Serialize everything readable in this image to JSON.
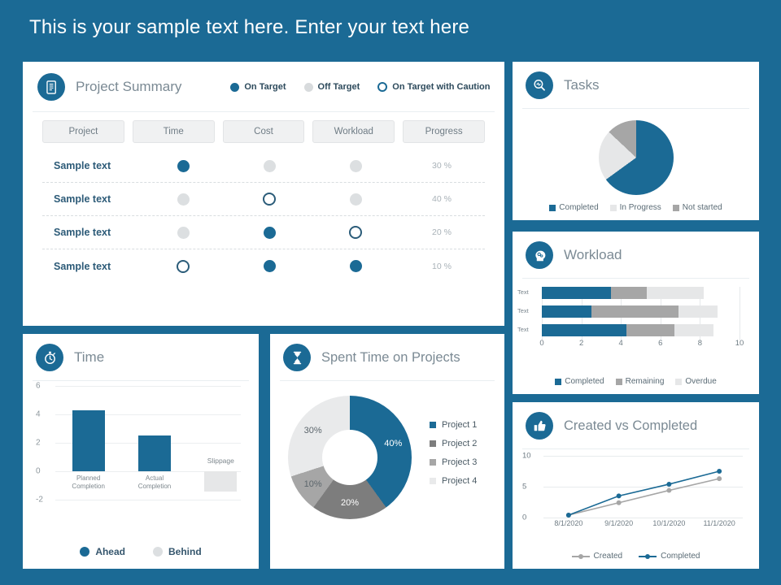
{
  "header": {
    "title": "This is your sample text here. Enter your text here"
  },
  "theme": {
    "brand_blue": "#1b6a95",
    "dark_gray": "#7d7d7d",
    "mid_gray": "#a6a6a6",
    "light_gray": "#e6e7e8",
    "pale_gray": "#d9dcde"
  },
  "project_summary": {
    "title": "Project Summary",
    "icon": "document-list-icon",
    "legend": [
      {
        "label": "On Target",
        "style": "filled"
      },
      {
        "label": "Off Target",
        "style": "gray"
      },
      {
        "label": "On Target with Caution",
        "style": "ring"
      }
    ],
    "columns": [
      "Project",
      "Time",
      "Cost",
      "Workload",
      "Progress"
    ],
    "rows": [
      {
        "name": "Sample text",
        "time": "filled",
        "cost": "gray",
        "workload": "gray",
        "progress": "30 %"
      },
      {
        "name": "Sample text",
        "time": "gray",
        "cost": "ring",
        "workload": "gray",
        "progress": "40 %"
      },
      {
        "name": "Sample text",
        "time": "gray",
        "cost": "filled",
        "workload": "ring",
        "progress": "20 %"
      },
      {
        "name": "Sample text",
        "time": "ring",
        "cost": "filled",
        "workload": "filled",
        "progress": "10 %"
      }
    ]
  },
  "tasks": {
    "title": "Tasks",
    "icon": "magnifier-analytics-icon",
    "chart_data": {
      "type": "pie",
      "title": "Tasks",
      "categories": [
        "Completed",
        "In Progress",
        "Not started"
      ],
      "values": [
        65,
        22,
        13
      ],
      "colors": [
        "#1b6a95",
        "#e6e7e8",
        "#a6a6a6"
      ],
      "legend_position": "bottom"
    }
  },
  "workload": {
    "title": "Workload",
    "icon": "head-gears-icon",
    "chart_data": {
      "type": "bar",
      "orientation": "horizontal",
      "stacked": true,
      "title": "Workload",
      "categories": [
        "Text",
        "Text",
        "Text"
      ],
      "series": [
        {
          "name": "Completed",
          "color": "#1b6a95",
          "values": [
            3.5,
            2.5,
            4.3
          ]
        },
        {
          "name": "Remaining",
          "color": "#a6a6a6",
          "values": [
            1.8,
            4.4,
            2.4
          ]
        },
        {
          "name": "Overdue",
          "color": "#e6e7e8",
          "values": [
            2.9,
            2.0,
            2.0
          ]
        }
      ],
      "xticks": [
        0,
        2,
        4,
        6,
        8,
        10
      ],
      "xlim": [
        0,
        10
      ],
      "grid": true,
      "legend_position": "bottom"
    }
  },
  "created_vs_completed": {
    "title": "Created vs Completed",
    "icon": "thumbs-up-icon",
    "chart_data": {
      "type": "line",
      "title": "Created vs Completed",
      "x": [
        "8/1/2020",
        "9/1/2020",
        "10/1/2020",
        "11/1/2020"
      ],
      "series": [
        {
          "name": "Created",
          "color": "#a6a6a6",
          "values": [
            0.4,
            2.4,
            4.4,
            6.3
          ]
        },
        {
          "name": "Completed",
          "color": "#1b6a95",
          "values": [
            0.4,
            3.5,
            5.4,
            7.5
          ]
        }
      ],
      "yticks": [
        0,
        5,
        10
      ],
      "ylim": [
        0,
        10
      ],
      "grid": true,
      "legend_position": "bottom"
    }
  },
  "time": {
    "title": "Time",
    "icon": "stopwatch-icon",
    "chart_data": {
      "type": "bar",
      "title": "Time",
      "categories": [
        "Planned Completion",
        "Actual Completion",
        "Slippage"
      ],
      "values": [
        4.3,
        2.5,
        -1.4
      ],
      "colors": [
        "#1b6a95",
        "#1b6a95",
        "#e6e7e8"
      ],
      "yticks": [
        -2,
        0,
        2,
        4,
        6
      ],
      "ylim": [
        -2,
        6
      ],
      "grid": true,
      "legend": [
        "Ahead",
        "Behind"
      ],
      "legend_position": "bottom"
    }
  },
  "spent_time": {
    "title": "Spent Time on Projects",
    "icon": "hourglass-icon",
    "chart_data": {
      "type": "pie",
      "variant": "donut",
      "title": "Spent Time on Projects",
      "categories": [
        "Project 1",
        "Project 2",
        "Project 3",
        "Project 4"
      ],
      "values": [
        40,
        20,
        10,
        30
      ],
      "labels": [
        "40%",
        "20%",
        "10%",
        "30%"
      ],
      "colors": [
        "#1b6a95",
        "#7d7d7d",
        "#a6a6a6",
        "#e9eaeb"
      ],
      "legend_position": "right"
    }
  }
}
